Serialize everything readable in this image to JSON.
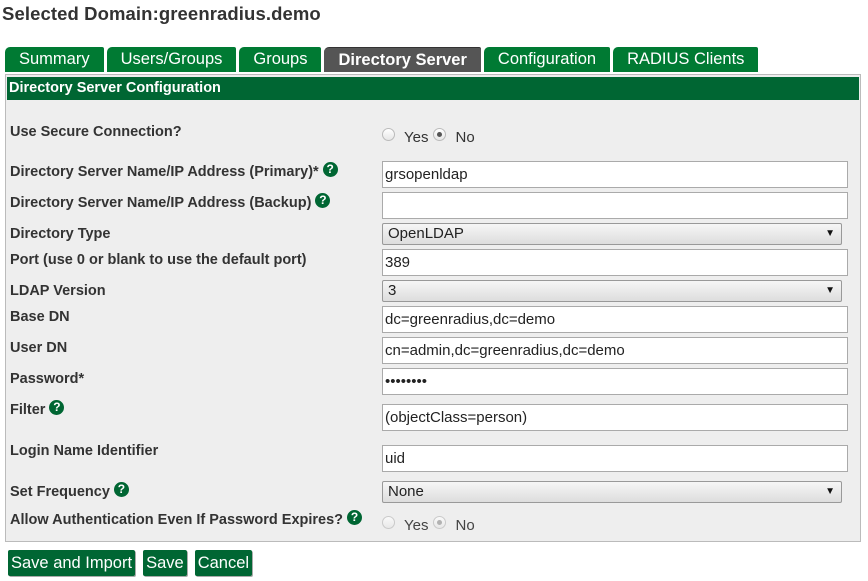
{
  "page_title": "Selected Domain:greenradius.demo",
  "tabs": [
    {
      "label": "Summary",
      "active": false
    },
    {
      "label": "Users/Groups",
      "active": false
    },
    {
      "label": "Groups",
      "active": false
    },
    {
      "label": "Directory Server",
      "active": true
    },
    {
      "label": "Configuration",
      "active": false
    },
    {
      "label": "RADIUS Clients",
      "active": false
    }
  ],
  "panel": {
    "title": "Directory Server Configuration",
    "fields": {
      "secure_connection": {
        "label": "Use Secure Connection?",
        "options": [
          "Yes",
          "No"
        ],
        "selected": "No"
      },
      "server_primary": {
        "label": "Directory Server Name/IP Address (Primary)*",
        "value": "grsopenldap"
      },
      "server_backup": {
        "label": "Directory Server Name/IP Address (Backup)",
        "value": ""
      },
      "directory_type": {
        "label": "Directory Type",
        "value": "OpenLDAP"
      },
      "port": {
        "label": "Port (use 0 or blank to use the default port)",
        "value": "389"
      },
      "ldap_version": {
        "label": "LDAP Version",
        "value": "3"
      },
      "base_dn": {
        "label": "Base DN",
        "value": "dc=greenradius,dc=demo"
      },
      "user_dn": {
        "label": "User DN",
        "value": "cn=admin,dc=greenradius,dc=demo"
      },
      "password": {
        "label": "Password*",
        "value": "••••••••"
      },
      "filter": {
        "label": "Filter",
        "value": "(objectClass=person)"
      },
      "login_name_identifier": {
        "label": "Login Name Identifier",
        "value": "uid"
      },
      "set_frequency": {
        "label": "Set Frequency",
        "value": "None"
      },
      "allow_auth_password_expires": {
        "label": "Allow Authentication Even If Password Expires?",
        "options": [
          "Yes",
          "No"
        ],
        "selected": "No",
        "disabled": true
      }
    }
  },
  "icons": {
    "help": "?",
    "dropdown_arrow": "▼"
  },
  "buttons": {
    "save_and_import": "Save and Import",
    "save": "Save",
    "cancel": "Cancel"
  },
  "colors": {
    "tab_green": "#007a33",
    "header_green": "#006633",
    "active_tab": "#555555",
    "panel_bg": "#eeeeee"
  }
}
